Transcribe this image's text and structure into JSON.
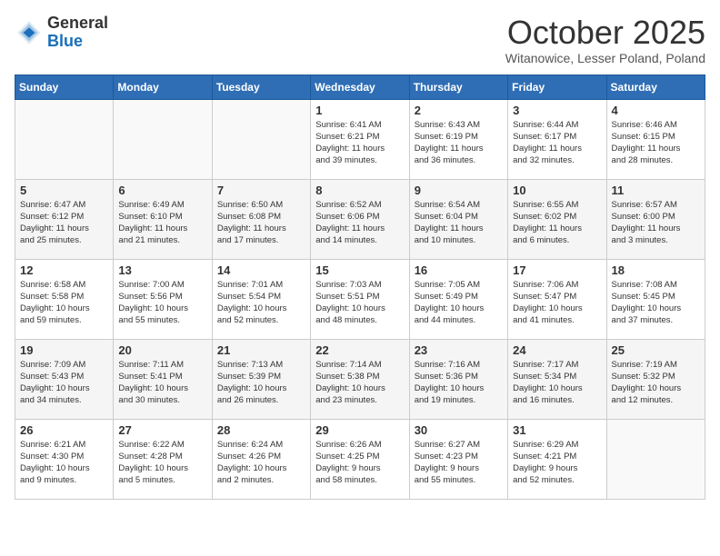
{
  "header": {
    "logo_general": "General",
    "logo_blue": "Blue",
    "title": "October 2025",
    "subtitle": "Witanowice, Lesser Poland, Poland"
  },
  "weekdays": [
    "Sunday",
    "Monday",
    "Tuesday",
    "Wednesday",
    "Thursday",
    "Friday",
    "Saturday"
  ],
  "weeks": [
    [
      {
        "day": "",
        "info": ""
      },
      {
        "day": "",
        "info": ""
      },
      {
        "day": "",
        "info": ""
      },
      {
        "day": "1",
        "info": "Sunrise: 6:41 AM\nSunset: 6:21 PM\nDaylight: 11 hours\nand 39 minutes."
      },
      {
        "day": "2",
        "info": "Sunrise: 6:43 AM\nSunset: 6:19 PM\nDaylight: 11 hours\nand 36 minutes."
      },
      {
        "day": "3",
        "info": "Sunrise: 6:44 AM\nSunset: 6:17 PM\nDaylight: 11 hours\nand 32 minutes."
      },
      {
        "day": "4",
        "info": "Sunrise: 6:46 AM\nSunset: 6:15 PM\nDaylight: 11 hours\nand 28 minutes."
      }
    ],
    [
      {
        "day": "5",
        "info": "Sunrise: 6:47 AM\nSunset: 6:12 PM\nDaylight: 11 hours\nand 25 minutes."
      },
      {
        "day": "6",
        "info": "Sunrise: 6:49 AM\nSunset: 6:10 PM\nDaylight: 11 hours\nand 21 minutes."
      },
      {
        "day": "7",
        "info": "Sunrise: 6:50 AM\nSunset: 6:08 PM\nDaylight: 11 hours\nand 17 minutes."
      },
      {
        "day": "8",
        "info": "Sunrise: 6:52 AM\nSunset: 6:06 PM\nDaylight: 11 hours\nand 14 minutes."
      },
      {
        "day": "9",
        "info": "Sunrise: 6:54 AM\nSunset: 6:04 PM\nDaylight: 11 hours\nand 10 minutes."
      },
      {
        "day": "10",
        "info": "Sunrise: 6:55 AM\nSunset: 6:02 PM\nDaylight: 11 hours\nand 6 minutes."
      },
      {
        "day": "11",
        "info": "Sunrise: 6:57 AM\nSunset: 6:00 PM\nDaylight: 11 hours\nand 3 minutes."
      }
    ],
    [
      {
        "day": "12",
        "info": "Sunrise: 6:58 AM\nSunset: 5:58 PM\nDaylight: 10 hours\nand 59 minutes."
      },
      {
        "day": "13",
        "info": "Sunrise: 7:00 AM\nSunset: 5:56 PM\nDaylight: 10 hours\nand 55 minutes."
      },
      {
        "day": "14",
        "info": "Sunrise: 7:01 AM\nSunset: 5:54 PM\nDaylight: 10 hours\nand 52 minutes."
      },
      {
        "day": "15",
        "info": "Sunrise: 7:03 AM\nSunset: 5:51 PM\nDaylight: 10 hours\nand 48 minutes."
      },
      {
        "day": "16",
        "info": "Sunrise: 7:05 AM\nSunset: 5:49 PM\nDaylight: 10 hours\nand 44 minutes."
      },
      {
        "day": "17",
        "info": "Sunrise: 7:06 AM\nSunset: 5:47 PM\nDaylight: 10 hours\nand 41 minutes."
      },
      {
        "day": "18",
        "info": "Sunrise: 7:08 AM\nSunset: 5:45 PM\nDaylight: 10 hours\nand 37 minutes."
      }
    ],
    [
      {
        "day": "19",
        "info": "Sunrise: 7:09 AM\nSunset: 5:43 PM\nDaylight: 10 hours\nand 34 minutes."
      },
      {
        "day": "20",
        "info": "Sunrise: 7:11 AM\nSunset: 5:41 PM\nDaylight: 10 hours\nand 30 minutes."
      },
      {
        "day": "21",
        "info": "Sunrise: 7:13 AM\nSunset: 5:39 PM\nDaylight: 10 hours\nand 26 minutes."
      },
      {
        "day": "22",
        "info": "Sunrise: 7:14 AM\nSunset: 5:38 PM\nDaylight: 10 hours\nand 23 minutes."
      },
      {
        "day": "23",
        "info": "Sunrise: 7:16 AM\nSunset: 5:36 PM\nDaylight: 10 hours\nand 19 minutes."
      },
      {
        "day": "24",
        "info": "Sunrise: 7:17 AM\nSunset: 5:34 PM\nDaylight: 10 hours\nand 16 minutes."
      },
      {
        "day": "25",
        "info": "Sunrise: 7:19 AM\nSunset: 5:32 PM\nDaylight: 10 hours\nand 12 minutes."
      }
    ],
    [
      {
        "day": "26",
        "info": "Sunrise: 6:21 AM\nSunset: 4:30 PM\nDaylight: 10 hours\nand 9 minutes."
      },
      {
        "day": "27",
        "info": "Sunrise: 6:22 AM\nSunset: 4:28 PM\nDaylight: 10 hours\nand 5 minutes."
      },
      {
        "day": "28",
        "info": "Sunrise: 6:24 AM\nSunset: 4:26 PM\nDaylight: 10 hours\nand 2 minutes."
      },
      {
        "day": "29",
        "info": "Sunrise: 6:26 AM\nSunset: 4:25 PM\nDaylight: 9 hours\nand 58 minutes."
      },
      {
        "day": "30",
        "info": "Sunrise: 6:27 AM\nSunset: 4:23 PM\nDaylight: 9 hours\nand 55 minutes."
      },
      {
        "day": "31",
        "info": "Sunrise: 6:29 AM\nSunset: 4:21 PM\nDaylight: 9 hours\nand 52 minutes."
      },
      {
        "day": "",
        "info": ""
      }
    ]
  ]
}
